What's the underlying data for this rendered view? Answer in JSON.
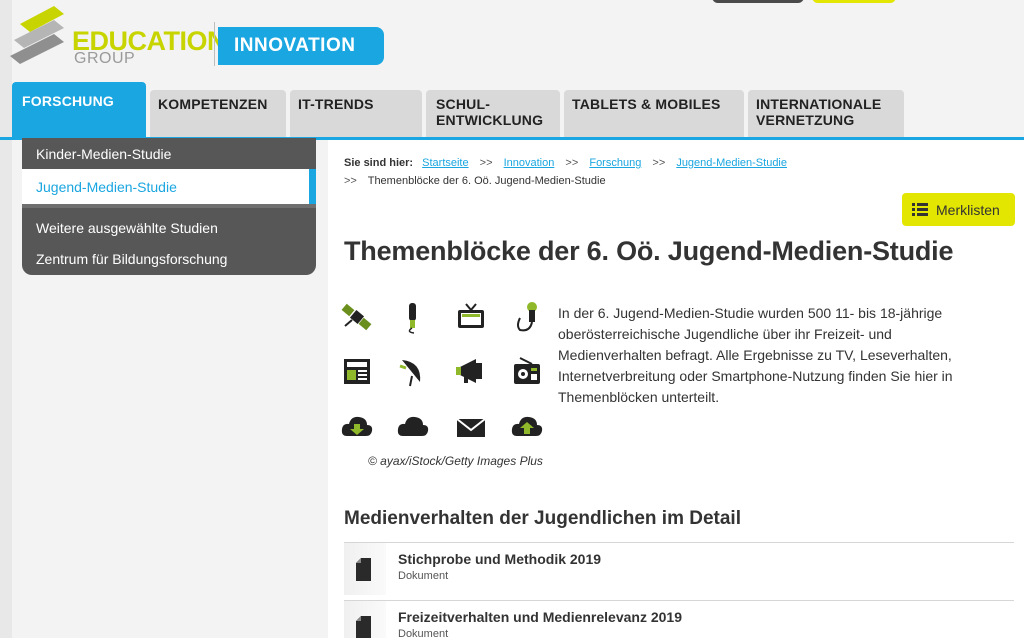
{
  "brand": {
    "logo_line1": "EDUCATION",
    "logo_line2": "GROUP",
    "section": "INNOVATION",
    "accent": "#1aa6e0",
    "logo_green": "#c8d400",
    "highlight_yellow": "#e2e600"
  },
  "nav": {
    "tabs": [
      {
        "label": "FORSCHUNG",
        "active": true
      },
      {
        "label": "KOMPETENZEN"
      },
      {
        "label": "IT-TRENDS"
      },
      {
        "label": "SCHUL-\nENTWICKLUNG"
      },
      {
        "label": "TABLETS & MOBILES"
      },
      {
        "label": "INTERNATIONALE\nVERNETZUNG"
      }
    ]
  },
  "sidebar": {
    "items": [
      {
        "label": "Kinder-Medien-Studie"
      },
      {
        "label": "Jugend-Medien-Studie",
        "active": true
      },
      {
        "label": "Weitere ausgewählte Studien"
      },
      {
        "label": "Zentrum für Bildungsforschung"
      }
    ]
  },
  "breadcrumb": {
    "label": "Sie sind hier:",
    "links": [
      "Startseite",
      "Innovation",
      "Forschung",
      "Jugend-Medien-Studie"
    ],
    "separator": ">>",
    "current": "Themenblöcke der 6. Oö. Jugend-Medien-Studie"
  },
  "toolbar": {
    "merklisten_label": "Merklisten"
  },
  "main": {
    "title": "Themenblöcke der 6. Oö. Jugend-Medien-Studie",
    "image_icons": [
      "satellite-icon",
      "electric-toothbrush-icon",
      "tv-icon",
      "microphone-icon",
      "newspaper-icon",
      "satellite-dish-icon",
      "megaphone-icon",
      "radio-icon",
      "cloud-download-icon",
      "cloud-icon",
      "envelope-icon",
      "cloud-upload-icon"
    ],
    "image_credit": "© ayax/iStock/Getty Images Plus",
    "intro": "In der 6. Jugend-Medien-Studie wurden 500 11- bis 18-jährige oberösterreichische Jugendliche über ihr Freizeit- und Medienverhalten befragt. Alle Ergebnisse zu TV, Leseverhalten, Internetverbreitung oder Smartphone-Nutzung finden Sie hier in Themenblöcken unterteilt.",
    "section_title": "Medienverhalten der Jugendlichen im Detail",
    "documents": [
      {
        "title": "Stichprobe und Methodik 2019",
        "type": "Dokument"
      },
      {
        "title": "Freizeitverhalten und Medienrelevanz 2019",
        "type": "Dokument"
      }
    ]
  }
}
